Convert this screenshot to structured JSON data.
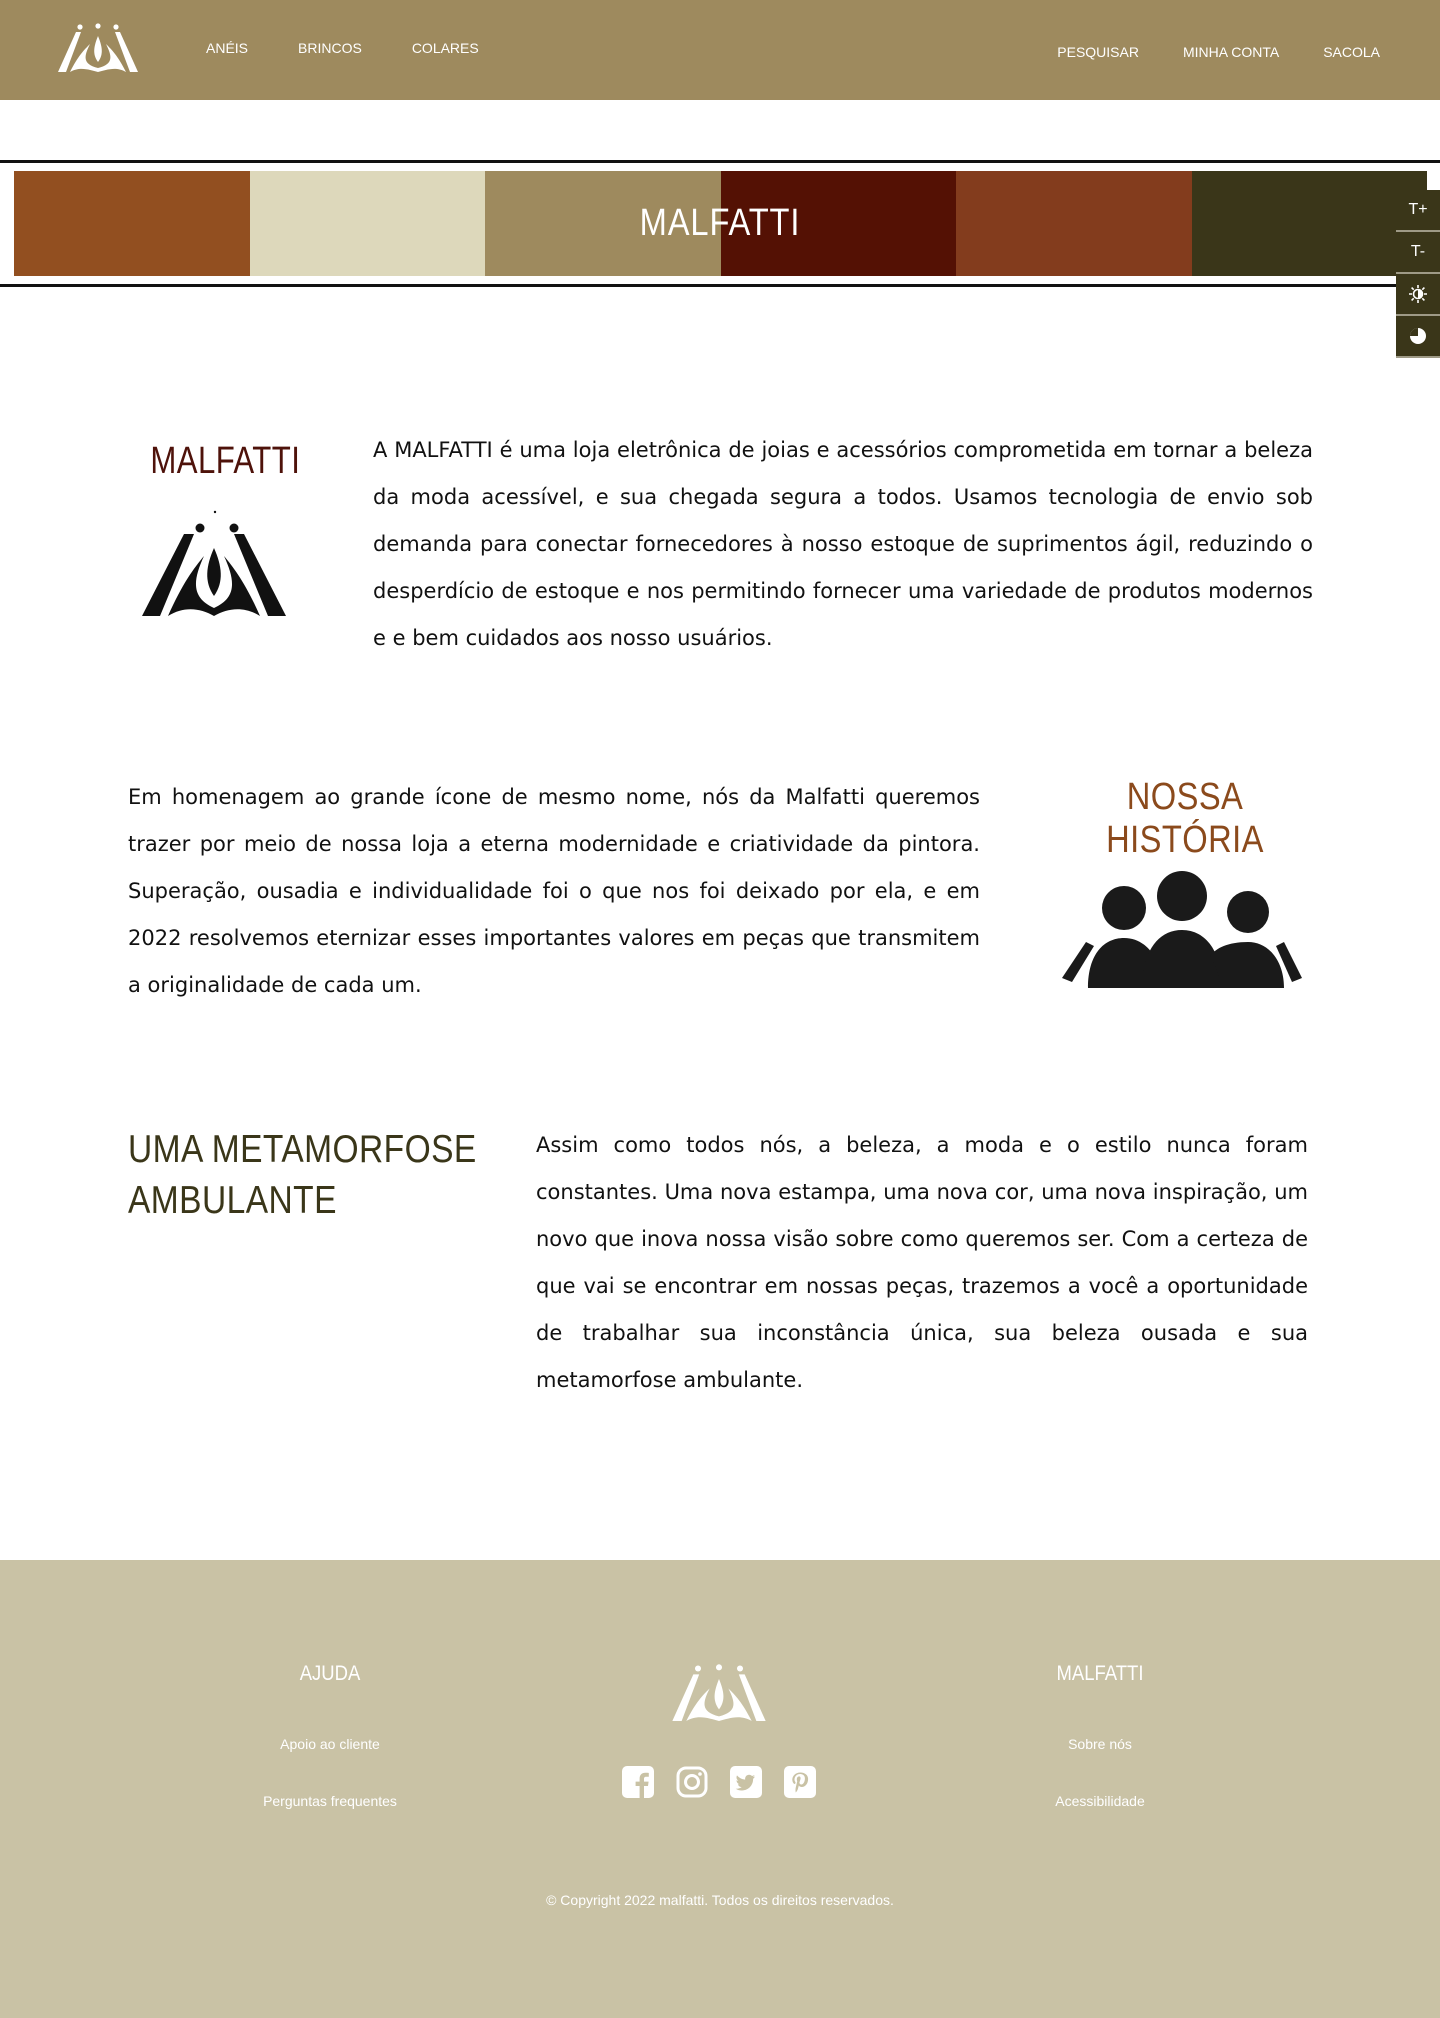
{
  "header": {
    "nav_left": [
      "ANÉIS",
      "BRINCOS",
      "COLARES"
    ],
    "nav_right": [
      "PESQUISAR",
      "MINHA CONTA",
      "SACOLA"
    ]
  },
  "banner": {
    "title": "MALFATTI",
    "swatches": [
      "#924f20",
      "#ddd8bb",
      "#9e8a5e",
      "#541104",
      "#833c1d",
      "#3a3619"
    ]
  },
  "accessibility": {
    "increase_font": "T+",
    "decrease_font": "T-"
  },
  "section_about": {
    "title": "MALFATTI",
    "text": "A MALFATTI é uma loja eletrônica de joias e acessórios comprometida em tornar a beleza da moda acessível, e sua chegada segura a todos. Usamos tecnologia de envio sob demanda para conectar fornecedores à nosso estoque de suprimentos ágil, reduzindo o desperdício de estoque e nos permitindo fornecer uma variedade de produtos modernos e e bem cuidados aos nosso usuários."
  },
  "section_history": {
    "title": "NOSSA HISTÓRIA",
    "text": "Em homenagem ao grande ícone de mesmo nome, nós da Malfatti queremos trazer por meio de nossa loja a eterna modernidade e criatividade da pintora. Superação, ousadia e individualidade foi o que nos foi deixado por ela, e em 2022 resolvemos eternizar esses importantes valores em peças que transmitem a originalidade de cada um."
  },
  "section_metamorphosis": {
    "title": "UMA METAMORFOSE AMBULANTE",
    "text": "Assim como todos nós, a beleza, a moda e o estilo nunca foram constantes. Uma nova estampa, uma nova cor, uma nova inspiração, um novo que inova nossa visão sobre como queremos ser. Com a certeza de que vai se encontrar em nossas peças, trazemos a você a oportunidade de trabalhar sua inconstância única, sua beleza ousada e sua metamorfose ambulante."
  },
  "footer": {
    "help_title": "AJUDA",
    "help_links": [
      "Apoio ao cliente",
      "Perguntas frequentes"
    ],
    "brand_title": "MALFATTI",
    "brand_links": [
      "Sobre nós",
      "Acessibilidade"
    ],
    "socials": [
      "facebook-icon",
      "instagram-icon",
      "twitter-icon",
      "pinterest-icon"
    ],
    "copyright": "© Copyright 2022 malfatti. Todos os direitos reservados."
  },
  "colors": {
    "header_bg": "#9e8a5e",
    "footer_bg": "#c9c2a5",
    "accent_dark_red": "#4e120a",
    "accent_brown": "#8b4a1c",
    "accent_olive": "#3a3619"
  }
}
